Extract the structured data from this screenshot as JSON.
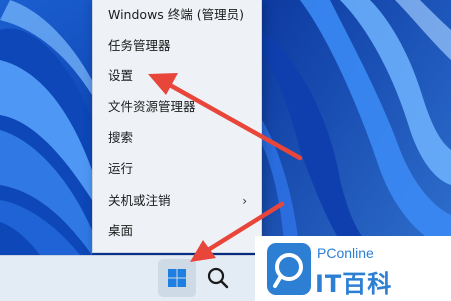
{
  "context_menu": {
    "items": [
      {
        "label": "Windows 终端 (管理员)"
      },
      {
        "label": "任务管理器"
      },
      {
        "label": "设置"
      },
      {
        "label": "文件资源管理器"
      },
      {
        "label": "搜索"
      },
      {
        "label": "运行"
      },
      {
        "label": "关机或注销",
        "has_submenu": true,
        "chevron": "›"
      },
      {
        "label": "桌面"
      }
    ]
  },
  "taskbar": {
    "start_icon": "windows-logo-icon",
    "search_icon": "search-icon"
  },
  "annotations": {
    "arrow_color": "#e8463a"
  },
  "watermark": {
    "brand_top": "PConline",
    "brand_main": "IT百科",
    "brand_color": "#2d7fd4"
  }
}
